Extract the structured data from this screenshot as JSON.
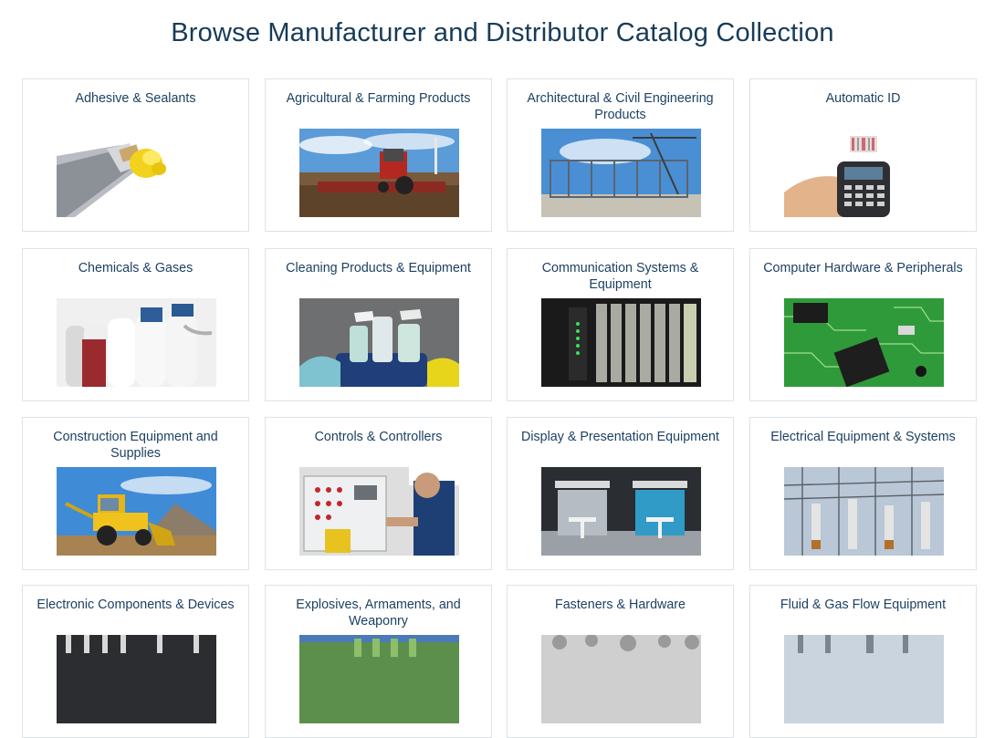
{
  "page": {
    "title": "Browse Manufacturer and Distributor Catalog Collection"
  },
  "categories": [
    {
      "label": "Adhesive & Sealants",
      "image": "adhesive-tube-image"
    },
    {
      "label": "Agricultural & Farming Products",
      "image": "tractor-field-image"
    },
    {
      "label": "Architectural & Civil Engineering Products",
      "image": "steel-frame-building-image"
    },
    {
      "label": "Automatic ID",
      "image": "barcode-scanner-image"
    },
    {
      "label": "Chemicals & Gases",
      "image": "gas-cylinders-image"
    },
    {
      "label": "Cleaning Products & Equipment",
      "image": "cleaning-supplies-image"
    },
    {
      "label": "Communication Systems & Equipment",
      "image": "network-rack-image"
    },
    {
      "label": "Computer Hardware & Peripherals",
      "image": "circuit-board-image"
    },
    {
      "label": "Construction Equipment and Supplies",
      "image": "backhoe-loader-image"
    },
    {
      "label": "Controls & Controllers",
      "image": "control-panel-technician-image"
    },
    {
      "label": "Display & Presentation Equipment",
      "image": "exhibition-booth-image"
    },
    {
      "label": "Electrical Equipment & Systems",
      "image": "electrical-substation-image"
    },
    {
      "label": "Electronic Components & Devices",
      "image": "electronic-components-image"
    },
    {
      "label": "Explosives, Armaments, and Weaponry",
      "image": "armaments-image"
    },
    {
      "label": "Fasteners & Hardware",
      "image": "fasteners-image"
    },
    {
      "label": "Fluid & Gas Flow Equipment",
      "image": "fluid-gas-plant-image"
    }
  ]
}
